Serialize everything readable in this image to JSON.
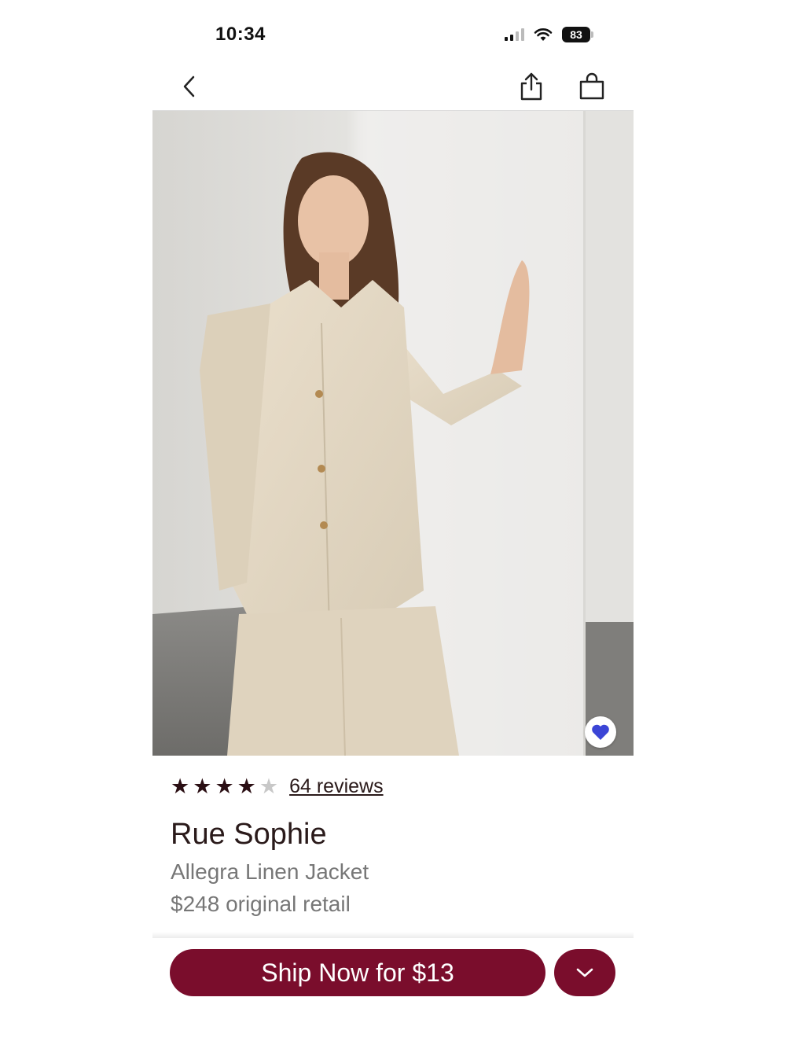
{
  "status_bar": {
    "time": "10:34",
    "battery": "83"
  },
  "nav": {
    "back_icon": "chevron-left-icon",
    "share_icon": "share-icon",
    "bag_icon": "shopping-bag-icon"
  },
  "gallery": {
    "favorite_icon": "heart-icon",
    "favorite_color": "#3b45d6"
  },
  "product": {
    "rating": 4,
    "rating_max": 5,
    "reviews_label": "64 reviews",
    "brand": "Rue Sophie",
    "name": "Allegra Linen Jacket",
    "price": "$248 original retail"
  },
  "actions": {
    "ship_label": "Ship Now for $13",
    "more_icon": "chevron-down-icon",
    "accent_color": "#7a0d2c"
  }
}
